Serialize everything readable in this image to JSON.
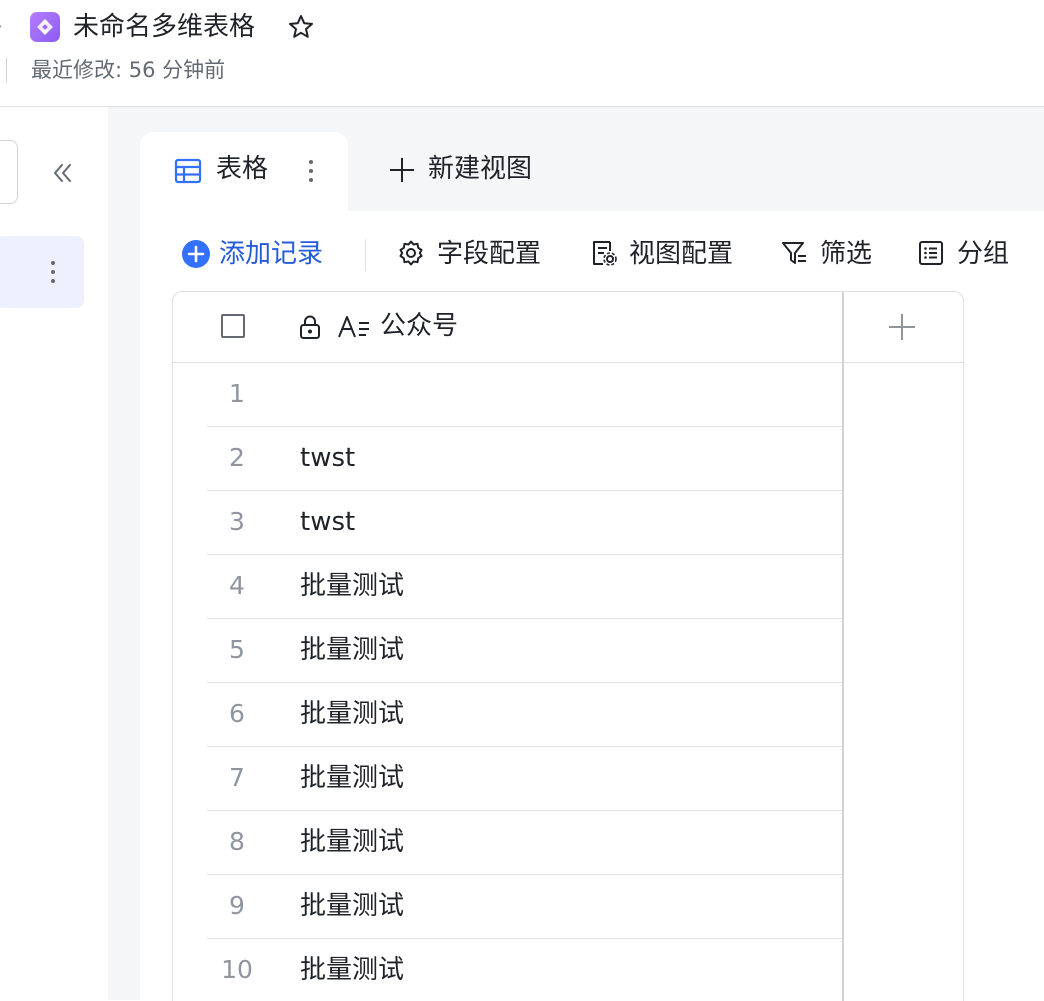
{
  "header": {
    "title": "未命名多维表格",
    "last_modified": "最近修改: 56 分钟前",
    "icons": {
      "app": "bitable-app-icon",
      "star": "star-icon",
      "back": "chevron-right-icon"
    },
    "colors": {
      "app_icon": "#9b6cf7"
    }
  },
  "sidebar": {
    "icons": {
      "collapse": "double-chevron-left-icon",
      "more": "more-vertical-icon"
    }
  },
  "tabs": [
    {
      "label": "表格",
      "icon": "table-icon",
      "active": true
    }
  ],
  "new_view_label": "新建视图",
  "toolbar": {
    "add_record": "添加记录",
    "field_config": "字段配置",
    "view_config": "视图配置",
    "filter": "筛选",
    "group": "分组",
    "colors": {
      "accent": "#245bdb",
      "add_icon": "#3370ff"
    }
  },
  "table": {
    "columns": [
      {
        "name": "公众号",
        "locked": true,
        "type": "text"
      }
    ],
    "rows": [
      {
        "num": "1",
        "value": ""
      },
      {
        "num": "2",
        "value": "twst"
      },
      {
        "num": "3",
        "value": "twst"
      },
      {
        "num": "4",
        "value": "批量测试"
      },
      {
        "num": "5",
        "value": "批量测试"
      },
      {
        "num": "6",
        "value": "批量测试"
      },
      {
        "num": "7",
        "value": "批量测试"
      },
      {
        "num": "8",
        "value": "批量测试"
      },
      {
        "num": "9",
        "value": "批量测试"
      },
      {
        "num": "10",
        "value": "批量测试"
      }
    ]
  }
}
